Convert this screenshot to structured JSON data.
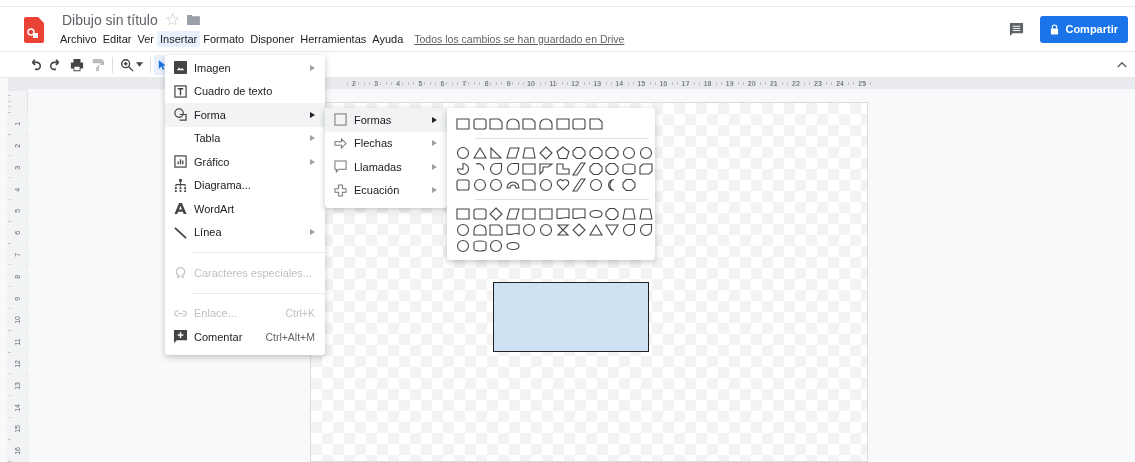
{
  "document": {
    "title": "Dibujo sin título",
    "save_status": "Todos los cambios se han guardado en Drive"
  },
  "menu_bar": [
    {
      "label": "Archivo",
      "selected": false
    },
    {
      "label": "Editar",
      "selected": false
    },
    {
      "label": "Ver",
      "selected": false
    },
    {
      "label": "Insertar",
      "selected": true
    },
    {
      "label": "Formato",
      "selected": false
    },
    {
      "label": "Disponer",
      "selected": false
    },
    {
      "label": "Herramientas",
      "selected": false
    },
    {
      "label": "Ayuda",
      "selected": false
    }
  ],
  "share_button": {
    "label": "Compartir"
  },
  "toolbar": {
    "select_tool": {
      "selected": true
    }
  },
  "ruler": {
    "horizontal": [
      "2",
      "3",
      "4",
      "5",
      "6",
      "7",
      "8",
      "9",
      "10",
      "11",
      "12",
      "13",
      "14",
      "15",
      "16",
      "17",
      "18",
      "19",
      "20",
      "21",
      "22",
      "23",
      "24",
      "25"
    ],
    "vertical": [
      "1",
      "2",
      "3",
      "4",
      "5",
      "6",
      "7",
      "8",
      "9",
      "10",
      "11",
      "12",
      "13",
      "14",
      "15",
      "16"
    ]
  },
  "insert_menu": {
    "items": [
      {
        "kind": "item",
        "label": "Imagen",
        "disabled": false,
        "submenu": true,
        "selected": false
      },
      {
        "kind": "item",
        "label": "Cuadro de texto",
        "disabled": false,
        "submenu": false,
        "selected": false
      },
      {
        "kind": "item",
        "label": "Forma",
        "disabled": false,
        "submenu": true,
        "selected": true
      },
      {
        "kind": "item",
        "label": "Tabla",
        "disabled": false,
        "submenu": true,
        "selected": false
      },
      {
        "kind": "item",
        "label": "Gráfico",
        "disabled": false,
        "submenu": true,
        "selected": false
      },
      {
        "kind": "item",
        "label": "Diagrama...",
        "disabled": false,
        "submenu": false,
        "selected": false
      },
      {
        "kind": "item",
        "label": "WordArt",
        "disabled": false,
        "submenu": false,
        "selected": false
      },
      {
        "kind": "item",
        "label": "Línea",
        "disabled": false,
        "submenu": true,
        "selected": false
      },
      {
        "kind": "separator"
      },
      {
        "kind": "item",
        "label": "Caracteres especiales...",
        "disabled": true,
        "submenu": false,
        "selected": false
      },
      {
        "kind": "separator"
      },
      {
        "kind": "item",
        "label": "Enlace...",
        "shortcut": "Ctrl+K",
        "disabled": true,
        "submenu": false,
        "selected": false
      },
      {
        "kind": "item",
        "label": "Comentar",
        "shortcut": "Ctrl+Alt+M",
        "disabled": false,
        "submenu": false,
        "selected": false
      }
    ]
  },
  "shape_submenu": {
    "items": [
      {
        "label": "Formas",
        "selected": true
      },
      {
        "label": "Flechas",
        "selected": false
      },
      {
        "label": "Llamadas",
        "selected": false
      },
      {
        "label": "Ecuación",
        "selected": false
      }
    ]
  }
}
